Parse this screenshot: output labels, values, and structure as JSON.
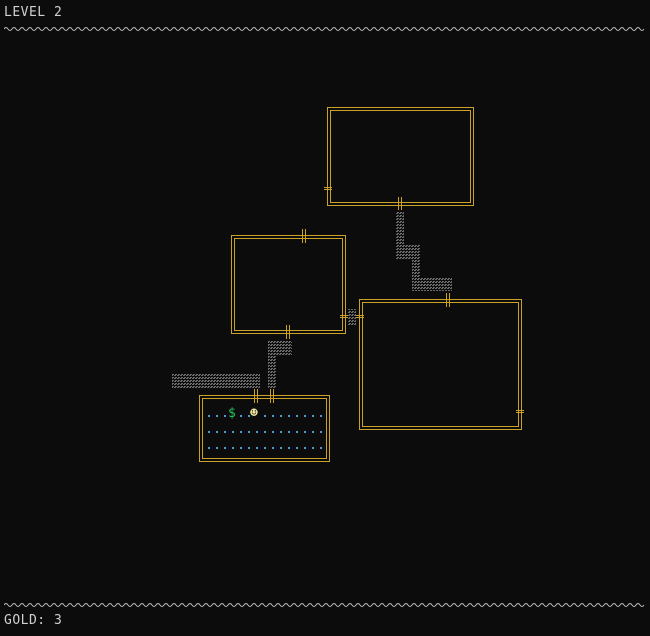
{
  "hud": {
    "level": "LEVEL 2",
    "gold": "GOLD: 3"
  },
  "colors": {
    "background": "#0c0c0c",
    "wall": "#c9a227",
    "corridor": "#6b6b6b",
    "floor_dot": "#4f9bd6",
    "gold": "#22c55e",
    "player": "#f0e6a0"
  },
  "map": {
    "gold_symbol": "$",
    "player_symbol": "☻"
  }
}
